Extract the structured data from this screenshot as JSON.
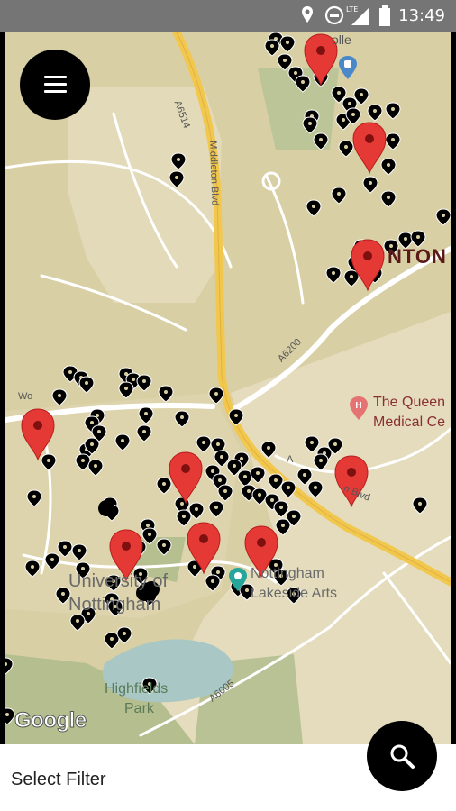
{
  "status_bar": {
    "time": "13:49",
    "network_label": "LTE",
    "icons": [
      "location-icon",
      "sync-icon",
      "lte-signal-icon",
      "battery-icon"
    ]
  },
  "menu_button": {
    "icon": "hamburger-icon"
  },
  "map": {
    "provider_logo": "Google",
    "labels": {
      "college_partial": "olle",
      "a6514": "A6514",
      "middleton_blvd": "Middleton Blvd",
      "lenton_partial": "NTON",
      "a6200": "A6200",
      "queens_medical_1": "The Queen",
      "queens_medical_2": "Medical Ce",
      "road_left_partial": "Wo",
      "lenton_blvd_partial": "n Blvd",
      "uni_1": "University of",
      "uni_2": "Nottingham",
      "lakeside_1": "Nottingham",
      "lakeside_2": "Lakeside Arts",
      "a6005": "A6005",
      "highfields_1": "Highfields",
      "highfields_2": "Park",
      "a_road_partial": "A"
    },
    "colors": {
      "land": "#d9cfa5",
      "campus": "#e4dcbd",
      "park": "#a9b98a",
      "water": "#a9c7c4",
      "major_road": "#f2c74e",
      "minor_road": "#ffffff",
      "pin_red": "#e53935",
      "marker": "#000000"
    }
  },
  "search_button": {
    "icon": "search-icon"
  },
  "bottom_bar": {
    "filter_label": "Select Filter"
  }
}
